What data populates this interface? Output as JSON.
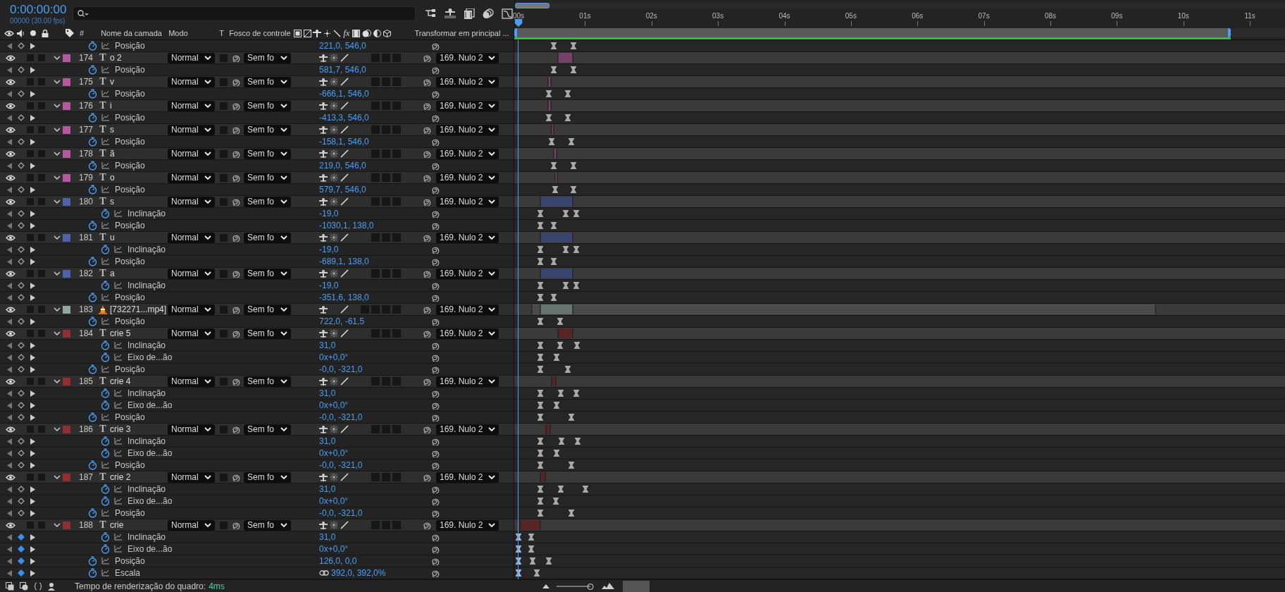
{
  "timecode": "0:00:00:00",
  "frame_info": "00000 (30.00 fps)",
  "columns": {
    "number": "#",
    "name": "Nome da camada",
    "mode": "Modo",
    "preserve": "T",
    "matte": "Fosco de controle",
    "fx": "fx",
    "parent": "Transformar em principal ..."
  },
  "navigator": {
    "level": 0.045
  },
  "ruler": [
    "00s",
    "01s",
    "02s",
    "03s",
    "04s",
    "05s",
    "06s",
    "07s",
    "08s",
    "09s",
    "10s",
    "11s"
  ],
  "work_area": {
    "level": 0.93
  },
  "playhead": {
    "level": 0.0046
  },
  "leading_properties": [
    {
      "kind": "transform",
      "name": "Posição",
      "value": "221,0, 546,0",
      "at_key": false,
      "keys": [
        {
          "level": 0.0515
        },
        {
          "level": 0.0771
        }
      ]
    }
  ],
  "layers": [
    {
      "kind": "text",
      "icon": "T",
      "number": "174",
      "name": "o 2",
      "color": "#b5589e",
      "visible": true,
      "expanded": true,
      "mode": "Normal",
      "matte": "Sem fo",
      "parent": "169. Nulo 2",
      "bar": {
        "start": {
          "level": 0.0569
        },
        "end": {
          "level": 0.076
        }
      },
      "properties": [
        {
          "kind": "transform",
          "name": "Posição",
          "value": "581,7, 546,0",
          "at_key": false,
          "keys": [
            {
              "level": 0.0515
            },
            {
              "level": 0.0771
            }
          ]
        }
      ]
    },
    {
      "kind": "text",
      "icon": "T",
      "number": "175",
      "name": "v",
      "color": "#b5589e",
      "visible": true,
      "expanded": true,
      "mode": "Normal",
      "matte": "Sem fo",
      "parent": "169. Nulo 2",
      "bar": {
        "start": {
          "level": 0.0441
        },
        "end": {
          "level": 0.0473
        }
      },
      "properties": [
        {
          "kind": "transform",
          "name": "Posição",
          "value": "-666,1, 546,0",
          "at_key": false,
          "keys": [
            {
              "level": 0.0452
            },
            {
              "level": 0.0697
            }
          ]
        }
      ]
    },
    {
      "kind": "text",
      "icon": "T",
      "number": "176",
      "name": "i",
      "color": "#b5589e",
      "visible": true,
      "expanded": true,
      "mode": "Normal",
      "matte": "Sem fo",
      "parent": "169. Nulo 2",
      "bar": {
        "start": {
          "level": 0.0441
        },
        "end": {
          "level": 0.0473
        }
      },
      "properties": [
        {
          "kind": "transform",
          "name": "Posição",
          "value": "-413,3, 546,0",
          "at_key": false,
          "keys": [
            {
              "level": 0.0452
            },
            {
              "level": 0.0697
            }
          ]
        }
      ]
    },
    {
      "kind": "text",
      "icon": "T",
      "number": "177",
      "name": "s",
      "color": "#b5589e",
      "visible": true,
      "expanded": true,
      "mode": "Normal",
      "matte": "Sem fo",
      "parent": "169. Nulo 2",
      "bar": {
        "start": {
          "level": 0.0484
        },
        "end": {
          "level": 0.0515
        }
      },
      "properties": [
        {
          "kind": "transform",
          "name": "Posição",
          "value": "-158,1, 546,0",
          "at_key": false,
          "keys": [
            {
              "level": 0.0484
            },
            {
              "level": 0.0739
            }
          ]
        }
      ]
    },
    {
      "kind": "text",
      "icon": "T",
      "number": "178",
      "name": "ã",
      "color": "#b5589e",
      "visible": true,
      "expanded": true,
      "mode": "Normal",
      "matte": "Sem fo",
      "parent": "169. Nulo 2",
      "bar": {
        "start": {
          "level": 0.0515
        },
        "end": {
          "level": 0.0548
        }
      },
      "properties": [
        {
          "kind": "transform",
          "name": "Posição",
          "value": "219,0, 546,0",
          "at_key": false,
          "keys": [
            {
              "level": 0.0515
            },
            {
              "level": 0.0771
            }
          ]
        }
      ]
    },
    {
      "kind": "text",
      "icon": "T",
      "number": "179",
      "name": "o",
      "color": "#b5589e",
      "visible": true,
      "expanded": true,
      "mode": "Normal",
      "matte": "Sem fo",
      "parent": "169. Nulo 2",
      "bar": {
        "start": {
          "level": 0.0526
        },
        "end": {
          "level": 0.0558
        }
      },
      "properties": [
        {
          "kind": "transform",
          "name": "Posição",
          "value": "579,7, 546,0",
          "at_key": false,
          "keys": [
            {
              "level": 0.0526
            },
            {
              "level": 0.0771
            }
          ]
        }
      ]
    },
    {
      "kind": "text",
      "icon": "T",
      "number": "180",
      "name": "s",
      "color": "#4d62a8",
      "visible": true,
      "expanded": true,
      "mode": "Normal",
      "matte": "Sem fo",
      "parent": "169. Nulo 2",
      "bar": {
        "start": {
          "level": 0.0335
        },
        "end": {
          "level": 0.076
        }
      },
      "properties": [
        {
          "kind": "animator",
          "name": "Inclinação",
          "value": "-19,0",
          "at_key": false,
          "keys": [
            {
              "level": 0.0335
            },
            {
              "level": 0.0665
            },
            {
              "level": 0.0803
            }
          ]
        },
        {
          "kind": "transform",
          "name": "Posição",
          "value": "-1030,1, 138,0",
          "at_key": false,
          "keys": [
            {
              "level": 0.0335
            },
            {
              "level": 0.0515
            }
          ]
        }
      ]
    },
    {
      "kind": "text",
      "icon": "T",
      "number": "181",
      "name": "u",
      "color": "#4d62a8",
      "visible": true,
      "expanded": true,
      "mode": "Normal",
      "matte": "Sem fo",
      "parent": "169. Nulo 2",
      "bar": {
        "start": {
          "level": 0.0335
        },
        "end": {
          "level": 0.076
        }
      },
      "properties": [
        {
          "kind": "animator",
          "name": "Inclinação",
          "value": "-19,0",
          "at_key": false,
          "keys": [
            {
              "level": 0.0335
            },
            {
              "level": 0.0665
            },
            {
              "level": 0.0803
            }
          ]
        },
        {
          "kind": "transform",
          "name": "Posição",
          "value": "-689,1, 138,0",
          "at_key": false,
          "keys": [
            {
              "level": 0.0335
            },
            {
              "level": 0.0515
            }
          ]
        }
      ]
    },
    {
      "kind": "text",
      "icon": "T",
      "number": "182",
      "name": "a",
      "color": "#4d62a8",
      "visible": true,
      "expanded": true,
      "mode": "Normal",
      "matte": "Sem fo",
      "parent": "169. Nulo 2",
      "bar": {
        "start": {
          "level": 0.0335
        },
        "end": {
          "level": 0.076
        }
      },
      "properties": [
        {
          "kind": "animator",
          "name": "Inclinação",
          "value": "-19,0",
          "at_key": false,
          "keys": [
            {
              "level": 0.0335
            },
            {
              "level": 0.0665
            },
            {
              "level": 0.0803
            }
          ]
        },
        {
          "kind": "transform",
          "name": "Posição",
          "value": "-351,6, 138,0",
          "at_key": false,
          "keys": [
            {
              "level": 0.0335
            },
            {
              "level": 0.0515
            }
          ]
        }
      ]
    },
    {
      "kind": "footage",
      "number": "183",
      "name": "[732271...mp4]",
      "color": "#8fa8a2",
      "visible": true,
      "expanded": true,
      "mode": "Normal",
      "matte": "Sem fo",
      "parent": "169. Nulo 2",
      "source": {
        "start": {
          "level": 0.0229
        },
        "end": {
          "level": 0.832
        }
      },
      "bar": {
        "start": {
          "level": 0.0335
        },
        "end": {
          "level": 0.076
        }
      },
      "properties": [
        {
          "kind": "transform",
          "name": "Posição",
          "value": "722,0, -61,5",
          "at_key": false,
          "keys": [
            {
              "level": 0.0335
            },
            {
              "level": 0.059
            }
          ]
        }
      ]
    },
    {
      "kind": "text",
      "icon": "T",
      "number": "184",
      "name": "crie 5",
      "color": "#8e2f33",
      "visible": true,
      "expanded": true,
      "mode": "Normal",
      "matte": "Sem fo",
      "parent": "169. Nulo 2",
      "bar": {
        "start": {
          "level": 0.0569
        },
        "end": {
          "level": 0.076
        }
      },
      "properties": [
        {
          "kind": "animator",
          "name": "Inclinação",
          "value": "31,0",
          "at_key": false,
          "keys": [
            {
              "level": 0.0335
            },
            {
              "level": 0.059
            },
            {
              "level": 0.0813
            }
          ]
        },
        {
          "kind": "animator",
          "name": "Eixo de...ão",
          "value": "0x+0,0°",
          "at_key": false,
          "keys": [
            {
              "level": 0.0335
            },
            {
              "level": 0.0548
            }
          ]
        },
        {
          "kind": "transform",
          "name": "Posição",
          "value": "-0,0, -321,0",
          "at_key": false,
          "keys": [
            {
              "level": 0.0335
            },
            {
              "level": 0.0697
            }
          ]
        }
      ]
    },
    {
      "kind": "text",
      "icon": "T",
      "number": "185",
      "name": "crie 4",
      "color": "#8e2f33",
      "visible": true,
      "expanded": true,
      "mode": "Normal",
      "matte": "Sem fo",
      "parent": "169. Nulo 2",
      "bar": {
        "start": {
          "level": 0.0484
        },
        "end": {
          "level": 0.0537
        }
      },
      "properties": [
        {
          "kind": "animator",
          "name": "Inclinação",
          "value": "31,0",
          "at_key": false,
          "keys": [
            {
              "level": 0.0335
            },
            {
              "level": 0.0603
            },
            {
              "level": 0.0804
            }
          ]
        },
        {
          "kind": "animator",
          "name": "Eixo de...ão",
          "value": "0x+0,0°",
          "at_key": false,
          "keys": [
            {
              "level": 0.0335
            },
            {
              "level": 0.0548
            }
          ]
        },
        {
          "kind": "transform",
          "name": "Posição",
          "value": "-0,0, -321,0",
          "at_key": false,
          "keys": [
            {
              "level": 0.0335
            },
            {
              "level": 0.0739
            }
          ]
        }
      ]
    },
    {
      "kind": "text",
      "icon": "T",
      "number": "186",
      "name": "crie 3",
      "color": "#8e2f33",
      "visible": true,
      "expanded": true,
      "mode": "Normal",
      "matte": "Sem fo",
      "parent": "169. Nulo 2",
      "bar": {
        "start": {
          "level": 0.041
        },
        "end": {
          "level": 0.0462
        }
      },
      "properties": [
        {
          "kind": "animator",
          "name": "Inclinação",
          "value": "31,0",
          "at_key": false,
          "keys": [
            {
              "level": 0.0335
            },
            {
              "level": 0.0611
            },
            {
              "level": 0.0824
            }
          ]
        },
        {
          "kind": "animator",
          "name": "Eixo de...ão",
          "value": "0x+0,0°",
          "at_key": false,
          "keys": [
            {
              "level": 0.0335
            },
            {
              "level": 0.0548
            }
          ]
        },
        {
          "kind": "transform",
          "name": "Posição",
          "value": "-0,0, -321,0",
          "at_key": false,
          "keys": [
            {
              "level": 0.0335
            },
            {
              "level": 0.0739
            }
          ]
        }
      ]
    },
    {
      "kind": "text",
      "icon": "T",
      "number": "187",
      "name": "crie 2",
      "color": "#8e2f33",
      "visible": true,
      "expanded": true,
      "mode": "Normal",
      "matte": "Sem fo",
      "parent": "169. Nulo 2",
      "bar": {
        "start": {
          "level": 0.0335
        },
        "end": {
          "level": 0.0398
        }
      },
      "properties": [
        {
          "kind": "animator",
          "name": "Inclinação",
          "value": "31,0",
          "at_key": false,
          "keys": [
            {
              "level": 0.0335
            },
            {
              "level": 0.06
            },
            {
              "level": 0.092
            }
          ]
        },
        {
          "kind": "animator",
          "name": "Eixo de...ão",
          "value": "0x+0,0°",
          "at_key": false,
          "keys": [
            {
              "level": 0.0335
            },
            {
              "level": 0.0537
            }
          ]
        },
        {
          "kind": "transform",
          "name": "Posição",
          "value": "-0,0, -321,0",
          "at_key": false,
          "keys": [
            {
              "level": 0.0335
            },
            {
              "level": 0.0739
            }
          ]
        }
      ]
    },
    {
      "kind": "text",
      "icon": "T",
      "number": "188",
      "name": "crie",
      "color": "#8e2f33",
      "visible": true,
      "expanded": true,
      "mode": "Normal",
      "matte": "Sem fo",
      "parent": "169. Nulo 2",
      "bar": {
        "start": {
          "level": 0.0069
        },
        "end": {
          "level": 0.0335
        }
      },
      "properties": [
        {
          "kind": "animator",
          "name": "Inclinação",
          "value": "31,0",
          "at_key": true,
          "keys": [
            {
              "level": 0.0058
            },
            {
              "level": 0.0218
            }
          ]
        },
        {
          "kind": "animator",
          "name": "Eixo de...ão",
          "value": "0x+0,0°",
          "at_key": true,
          "keys": [
            {
              "level": 0.0058
            },
            {
              "level": 0.0218
            }
          ]
        },
        {
          "kind": "transform",
          "name": "Posição",
          "value": "126,0, 0,0",
          "at_key": true,
          "keys": [
            {
              "level": 0.0058
            },
            {
              "level": 0.0239
            },
            {
              "level": 0.0452
            }
          ]
        },
        {
          "kind": "transform",
          "name": "Escala",
          "value": "392,0, 392,0%",
          "linked": true,
          "at_key": true,
          "keys": [
            {
              "level": 0.0058
            },
            {
              "level": 0.0293
            }
          ]
        }
      ]
    }
  ],
  "status_bar": {
    "label": "Tempo de renderização do quadro:",
    "render_time": "4ms",
    "zoom": {
      "level": 1
    }
  }
}
